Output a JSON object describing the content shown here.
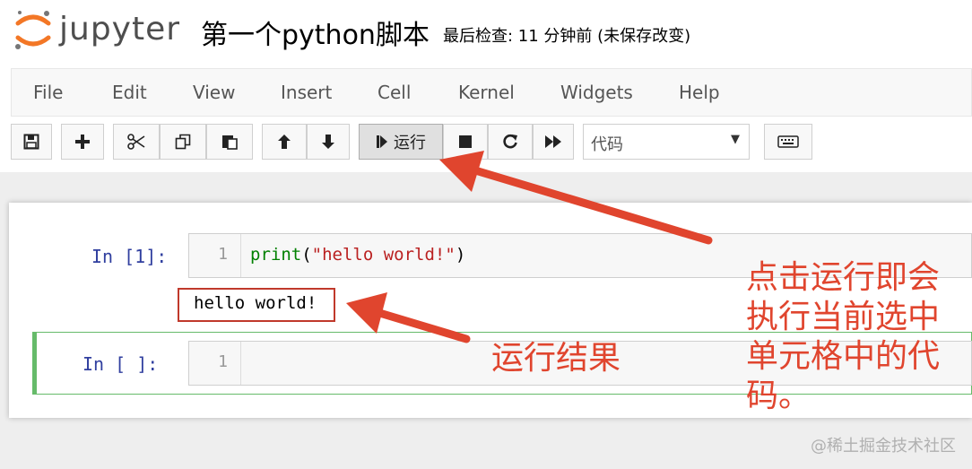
{
  "header": {
    "logo_text": "jupyter",
    "notebook_title": "第一个python脚本",
    "checkpoint": "最后检查: 11 分钟前  (未保存改变)"
  },
  "menu": {
    "items": [
      "File",
      "Edit",
      "View",
      "Insert",
      "Cell",
      "Kernel",
      "Widgets",
      "Help"
    ]
  },
  "toolbar": {
    "run_label": "运行",
    "cell_type": "代码"
  },
  "cells": [
    {
      "prompt": "In  [1]:",
      "line_number": "1",
      "code_func": "print",
      "code_open": "(",
      "code_string": "\"hello world!\"",
      "code_close": ")",
      "output": "hello world!"
    },
    {
      "prompt": "In  [ ]:",
      "line_number": "1"
    }
  ],
  "annotations": {
    "run_note": [
      "点击运行即会",
      "执行当前选中",
      "单元格中的代",
      "码。"
    ],
    "result_note": "运行结果"
  },
  "watermark": "@稀土掘金技术社区",
  "colors": {
    "annotation_red": "#e0452e",
    "jupyter_orange": "#f37726",
    "prompt_blue": "#303f9f",
    "selected_cell_green": "#66bb6a"
  }
}
